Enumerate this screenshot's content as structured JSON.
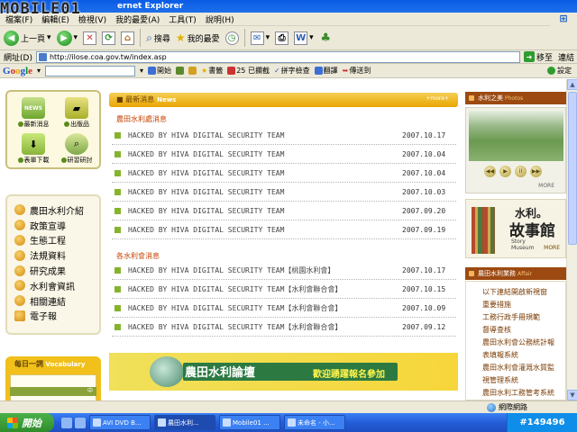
{
  "window": {
    "title": "ernet Explorer",
    "watermark": "MOBILE01"
  },
  "menu": [
    "檔案(F)",
    "編輯(E)",
    "檢視(V)",
    "我的最愛(A)",
    "工具(T)",
    "說明(H)"
  ],
  "toolbar": {
    "back": "上一頁",
    "search": "搜尋",
    "favorites": "我的最愛"
  },
  "address": {
    "label": "網址(D)",
    "url": "http://ilose.coa.gov.tw/index.asp",
    "go": "移至",
    "links": "連結"
  },
  "google": {
    "logo": [
      "G",
      "o",
      "o",
      "g",
      "l",
      "e"
    ],
    "search_go": "開始",
    "bookmarks": "書籤",
    "blocked": "25 已攔截",
    "spellcheck": "拼字檢查",
    "translate": "翻譯",
    "send_to": "傳送到",
    "settings": "設定"
  },
  "page": {
    "quick_links": [
      "最新消息",
      "出版品",
      "表單下載",
      "研習研討"
    ],
    "quick_icon_text": "NEWS",
    "nav_items": [
      "農田水利介紹",
      "政策宣導",
      "生態工程",
      "法規資料",
      "研究成果",
      "水利會資訊",
      "相關連結",
      "電子報"
    ],
    "vocabulary": {
      "title": "每日一詞",
      "en": "Vocabulary",
      "tag": "中"
    },
    "news": {
      "title": "最新消息",
      "title_en": "News",
      "more": "+more+",
      "section1": "農田水利處消息",
      "section2": "各水利會消息",
      "items1": [
        {
          "text": "HACKED BY HIVA DIGITAL SECURITY TEAM",
          "date": "2007.10.17"
        },
        {
          "text": "HACKED BY HIVA DIGITAL SECURITY TEAM",
          "date": "2007.10.04"
        },
        {
          "text": "HACKED BY HIVA DIGITAL SECURITY TEAM",
          "date": "2007.10.04"
        },
        {
          "text": "HACKED BY HIVA DIGITAL SECURITY TEAM",
          "date": "2007.10.03"
        },
        {
          "text": "HACKED BY HIVA DIGITAL SECURITY TEAM",
          "date": "2007.09.20"
        },
        {
          "text": "HACKED BY HIVA DIGITAL SECURITY TEAM",
          "date": "2007.09.19"
        }
      ],
      "items2": [
        {
          "text": "HACKED BY HIVA DIGITAL SECURITY TEAM【桃園水利會】",
          "date": "2007.10.17"
        },
        {
          "text": "HACKED BY HIVA DIGITAL SECURITY TEAM【水利會聯合會】",
          "date": "2007.10.15"
        },
        {
          "text": "HACKED BY HIVA DIGITAL SECURITY TEAM【水利會聯合會】",
          "date": "2007.10.09"
        },
        {
          "text": "HACKED BY HIVA DIGITAL SECURITY TEAM【水利會聯合會】",
          "date": "2007.09.12"
        }
      ]
    },
    "banner": {
      "title": "農田水利論壇",
      "subtitle": "歡迎踴躍報名參加"
    },
    "photos": {
      "title": "水利之美",
      "title_en": "Photos",
      "more": "MORE",
      "controls": [
        "◀◀",
        "▶",
        "II",
        "▶▶"
      ]
    },
    "museum": {
      "line1": "水利。",
      "line2": "故事館",
      "en1": "Story",
      "en2": "Museum",
      "more": "MORE"
    },
    "systems": {
      "title": "農田水利業務",
      "title_en": "Affair",
      "items": [
        "以下連結開啟新視窗",
        "重要措施",
        "工務行政手冊規範",
        "督導查核",
        "農田水利會公務統計報",
        "表填報系統",
        "農田水利會灌溉水質監",
        "視管理系統",
        "農田水利工務管考系統"
      ]
    }
  },
  "status": {
    "zone": "網際網路"
  },
  "taskbar": {
    "start": "開始",
    "tasks": [
      "AVI DVD B...",
      "農田水利...",
      "Mobile01 ...",
      "未命名 - 小..."
    ],
    "tray": "#149496"
  }
}
